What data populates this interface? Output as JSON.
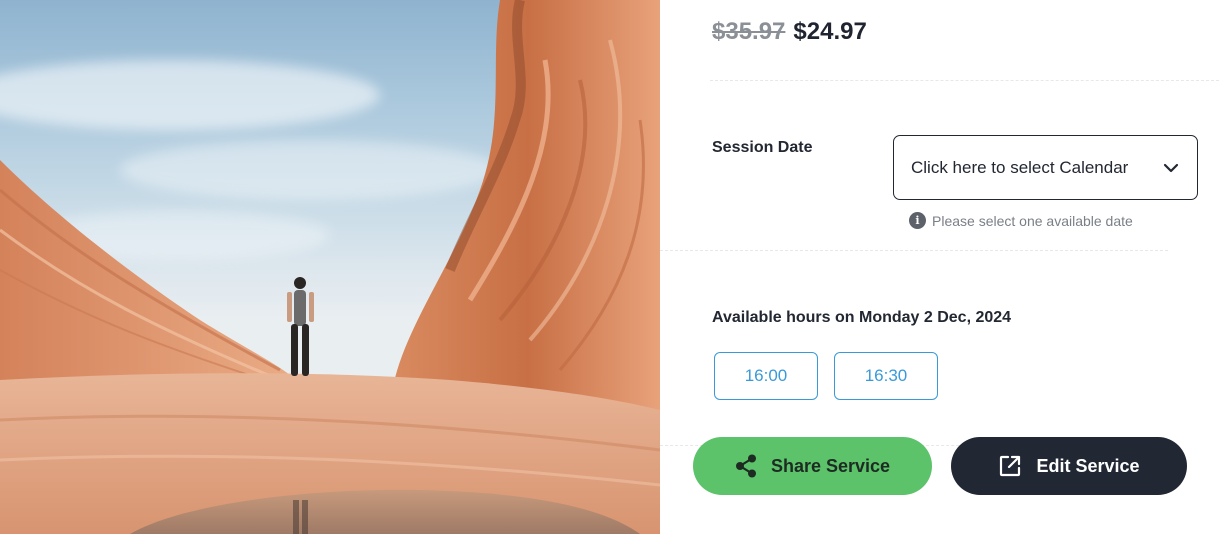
{
  "pricing": {
    "original_price": "$35.97",
    "sale_price": "$24.97"
  },
  "session": {
    "label": "Session Date",
    "select_text": "Click here to select Calendar",
    "hint": "Please select one available date"
  },
  "hours": {
    "label": "Available hours on Monday 2 Dec, 2024",
    "slots": [
      "16:00",
      "16:30"
    ]
  },
  "actions": {
    "share_label": "Share Service",
    "edit_label": "Edit Service"
  },
  "colors": {
    "accent_blue": "#3a9ad9",
    "share_green": "#5cc36a",
    "edit_dark": "#212834"
  },
  "icons": {
    "select": "chevron-down-icon",
    "hint": "info-icon",
    "share": "share-icon",
    "edit": "external-link-icon"
  }
}
